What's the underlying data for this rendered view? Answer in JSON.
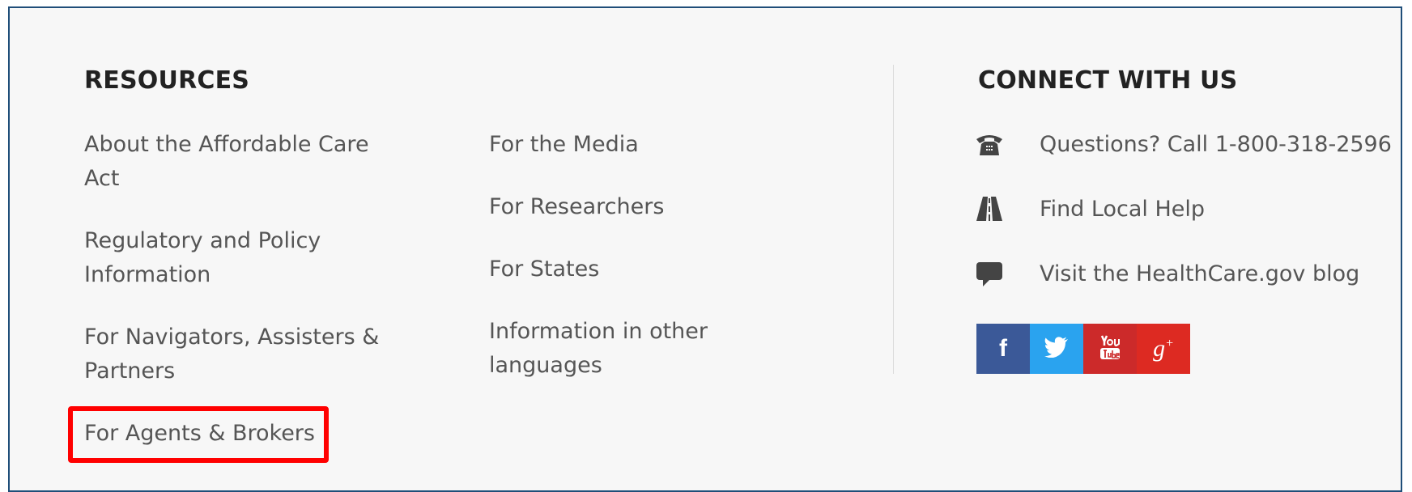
{
  "resources": {
    "heading": "RESOURCES",
    "column1": [
      "About the Affordable Care Act",
      "Regulatory and Policy Information",
      "For Navigators, Assisters & Partners",
      "For Agents & Brokers"
    ],
    "column2": [
      "For the Media",
      "For Researchers",
      "For States",
      "Information in other languages"
    ]
  },
  "connect": {
    "heading": "CONNECT WITH US",
    "items": [
      {
        "icon": "phone-icon",
        "label": "Questions? Call 1-800-318-2596"
      },
      {
        "icon": "road-icon",
        "label": "Find Local Help"
      },
      {
        "icon": "speech-bubble-icon",
        "label": "Visit the HealthCare.gov blog"
      }
    ],
    "social": [
      {
        "icon": "facebook-icon",
        "color": "#3b5998",
        "glyph": "f"
      },
      {
        "icon": "twitter-icon",
        "color": "#2aa3ef",
        "glyph": ""
      },
      {
        "icon": "youtube-icon",
        "color": "#cc2a2a",
        "glyph": ""
      },
      {
        "icon": "google-plus-icon",
        "color": "#dd2a22",
        "glyph": "g+"
      }
    ]
  },
  "annotation": {
    "highlight_color": "#ff0000"
  }
}
